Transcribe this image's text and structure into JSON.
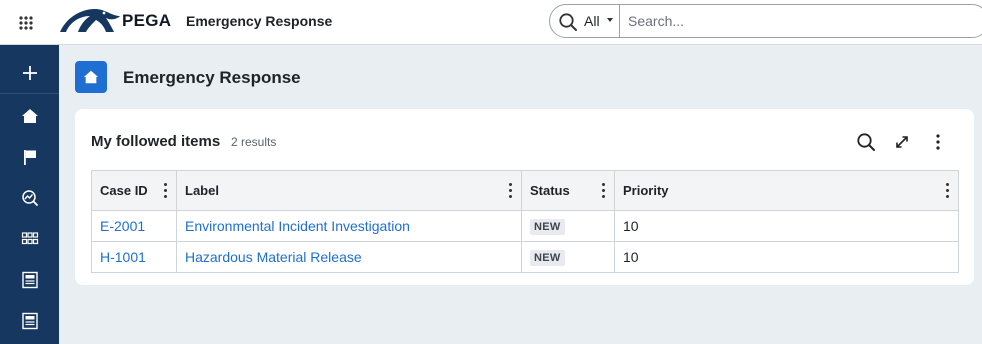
{
  "header": {
    "brand": "PEGA",
    "app_title": "Emergency Response",
    "search": {
      "scope": "All",
      "placeholder": "Search..."
    }
  },
  "sidebar": {
    "items": [
      {
        "name": "create",
        "icon": "plus-icon"
      },
      {
        "name": "home",
        "icon": "home-icon"
      },
      {
        "name": "flag",
        "icon": "flag-icon"
      },
      {
        "name": "explore-data",
        "icon": "chart-search-icon"
      },
      {
        "name": "apps",
        "icon": "grid-icon"
      },
      {
        "name": "documents-1",
        "icon": "document-icon"
      },
      {
        "name": "documents-2",
        "icon": "document-icon"
      }
    ]
  },
  "page": {
    "title": "Emergency Response"
  },
  "followed": {
    "title": "My followed items",
    "count": "2 results",
    "columns": [
      "Case ID",
      "Label",
      "Status",
      "Priority"
    ],
    "rows": [
      {
        "case_id": "E-2001",
        "label": "Environmental Incident Investigation",
        "status": "NEW",
        "priority": "10"
      },
      {
        "case_id": "H-1001",
        "label": "Hazardous Material Release",
        "status": "NEW",
        "priority": "10"
      }
    ]
  },
  "colors": {
    "sidebar_bg": "#16375f",
    "accent": "#1e6fd1",
    "link": "#1f6fd0",
    "page_bg": "#e9eef3"
  }
}
